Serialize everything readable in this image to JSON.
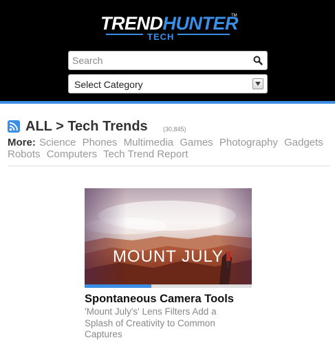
{
  "brand": {
    "name_part1": "TREND",
    "name_part2": "HUNTER",
    "trademark": "TM",
    "subtitle": "TECH"
  },
  "search": {
    "placeholder": "Search",
    "value": ""
  },
  "category_select": {
    "selected": "Select Category"
  },
  "breadcrumb": {
    "root": "ALL",
    "separator": ">",
    "current": "Tech Trends",
    "count": "(30,845)"
  },
  "more": {
    "label": "More:",
    "links": [
      "Science",
      "Phones",
      "Multimedia",
      "Games",
      "Photography",
      "Gadgets",
      "Robots",
      "Computers",
      "Tech Trend Report"
    ]
  },
  "article": {
    "image_text": "MOUNT JULY",
    "progress": 0.4,
    "title": "Spontaneous Camera Tools",
    "description": "'Mount July's' Lens Filters Add a Splash of Creativity to Common Captures"
  },
  "colors": {
    "header_bg": "#000000",
    "accent": "#3a8ee6",
    "link_gray": "#999999"
  }
}
